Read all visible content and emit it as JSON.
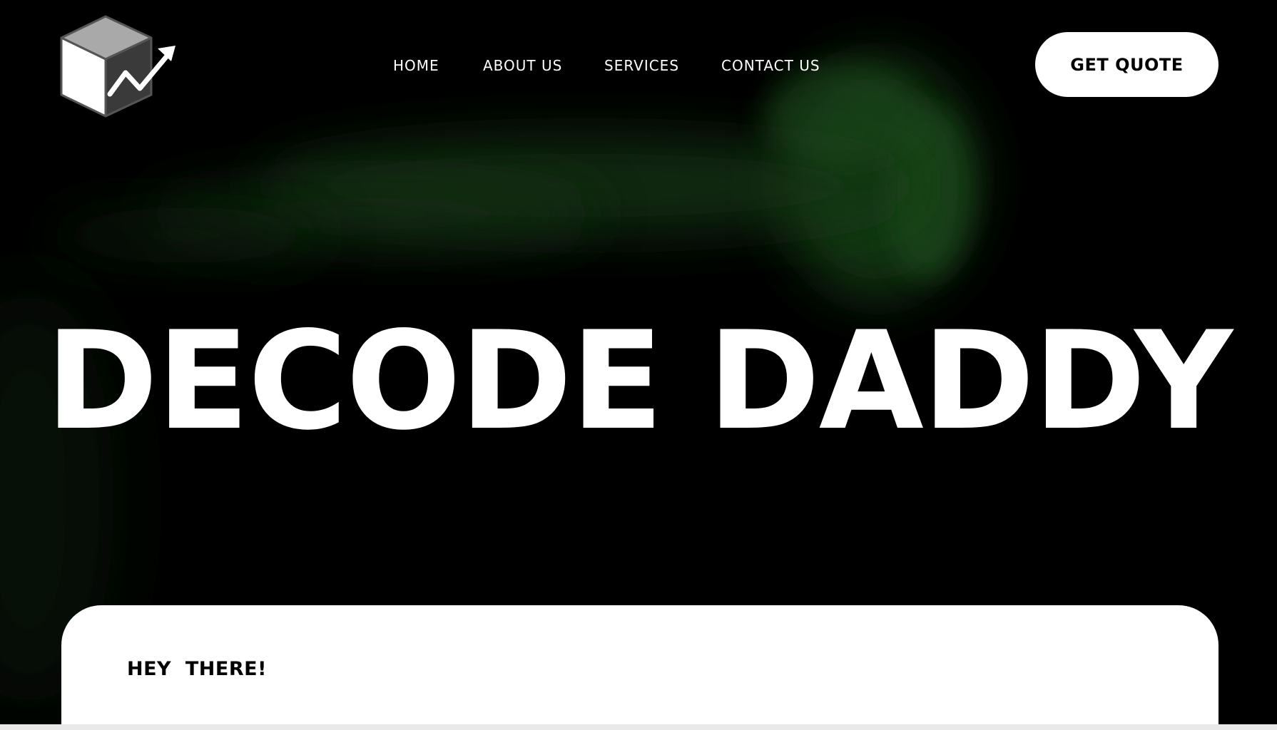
{
  "nav": {
    "items": [
      {
        "label": "HOME"
      },
      {
        "label": "ABOUT US"
      },
      {
        "label": "SERVICES"
      },
      {
        "label": "CONTACT US"
      }
    ]
  },
  "header": {
    "logo_icon": "cube-growth-arrow-icon",
    "cta_label": "GET QUOTE"
  },
  "hero": {
    "title": "DECODE DADDY",
    "background": "green-smoke-on-black",
    "accent_color": "#1f5a1f"
  },
  "card": {
    "heading": "HEY  THERE!"
  },
  "colors": {
    "background": "#000000",
    "text_primary": "#ffffff",
    "button_bg": "#ffffff",
    "button_text": "#000000",
    "card_bg": "#ffffff"
  }
}
